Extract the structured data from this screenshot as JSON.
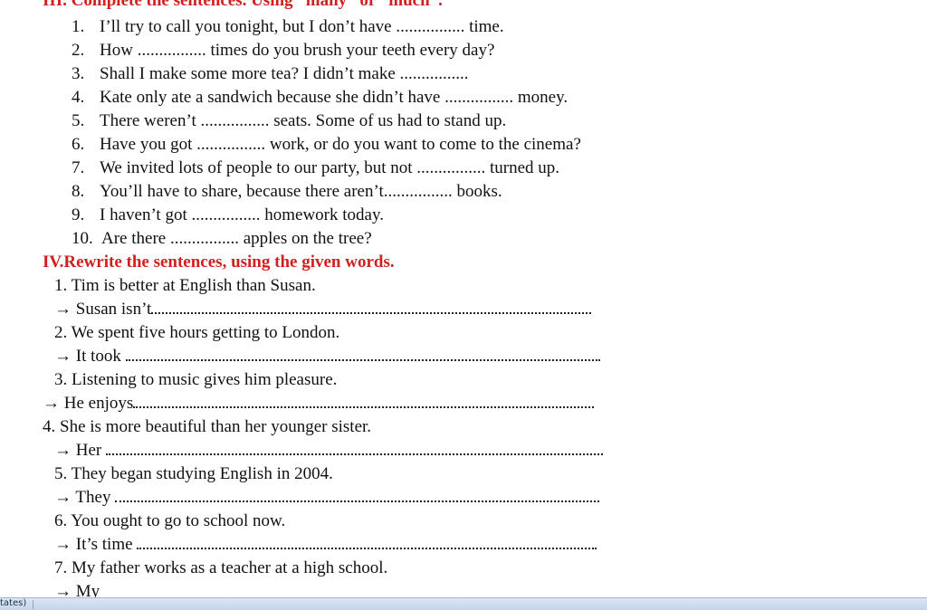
{
  "section3": {
    "heading": "III. Complete the sentences. Using “many” or “much”.",
    "items": [
      {
        "num": "1.",
        "before": "I’ll try to call you tonight, but I don’t have",
        "blank": "................",
        "after": "time."
      },
      {
        "num": "2.",
        "before": "How",
        "blank": "................",
        "after": "times do you brush your teeth every day?"
      },
      {
        "num": "3.",
        "before": "Shall I make some more tea? I didn’t make",
        "blank": "................",
        "after": ""
      },
      {
        "num": "4.",
        "before": "Kate only ate a sandwich because she didn’t have",
        "blank": "................",
        "after": "money."
      },
      {
        "num": "5.",
        "before": "There weren’t",
        "blank": "................",
        "after": "seats. Some of us had to stand up."
      },
      {
        "num": "6.",
        "before": "Have you got",
        "blank": "................",
        "after": "work, or do you want to come to the cinema?"
      },
      {
        "num": "7.",
        "before": "We invited lots of people to our party, but not",
        "blank": "................",
        "after": "turned up."
      },
      {
        "num": "8.",
        "before": "You’ll have to share, because there aren’t.",
        "blank": "...............",
        "after": "books."
      },
      {
        "num": "9.",
        "before": "I haven’t got",
        "blank": "................",
        "after": "homework today."
      },
      {
        "num": "10.",
        "before": "Are there",
        "blank": "................",
        "after": "apples on the tree?"
      }
    ]
  },
  "section4": {
    "heading": "IV.Rewrite the sentences, using the given words.",
    "items": [
      {
        "sentence": "1. Tim is better at English than Susan.",
        "prompt": "→ Susan isn’t"
      },
      {
        "sentence": "2. We spent five hours getting to London.",
        "prompt": "→ It took"
      },
      {
        "sentence": "3. Listening to music gives him pleasure.",
        "prompt": "→ He enjoys"
      },
      {
        "sentence": "4. She is more beautiful than her younger sister.",
        "prompt": "→ Her"
      },
      {
        "sentence": "5. They began studying English in 2004.",
        "prompt": "→ They"
      },
      {
        "sentence": "6. You ought to go to school now.",
        "prompt": "→ It’s time"
      },
      {
        "sentence": "7. My father works as a teacher at a high school.",
        "prompt": "→ My"
      }
    ]
  },
  "status_bar": {
    "text": "tates)"
  }
}
